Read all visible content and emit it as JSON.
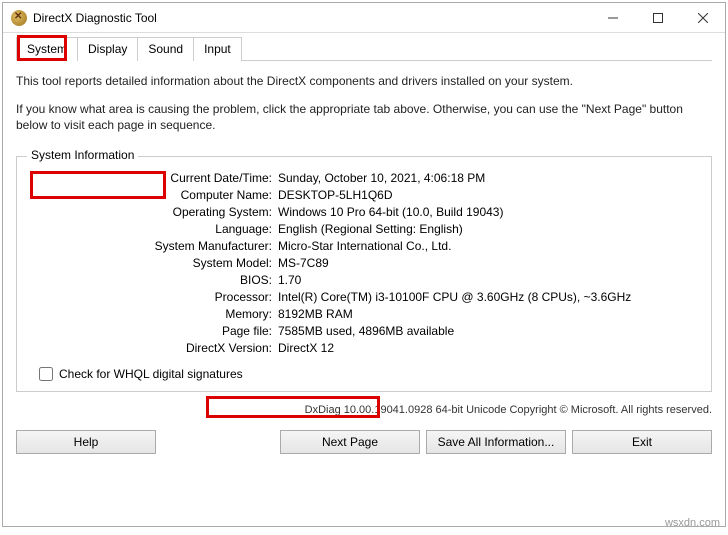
{
  "window": {
    "title": "DirectX Diagnostic Tool"
  },
  "tabs": [
    "System",
    "Display",
    "Sound",
    "Input"
  ],
  "intro": {
    "p1": "This tool reports detailed information about the DirectX components and drivers installed on your system.",
    "p2": "If you know what area is causing the problem, click the appropriate tab above.  Otherwise, you can use the \"Next Page\" button below to visit each page in sequence."
  },
  "group": {
    "title": "System Information"
  },
  "info": {
    "date_label": "Current Date/Time:",
    "date_val": "Sunday, October 10, 2021, 4:06:18 PM",
    "name_label": "Computer Name:",
    "name_val": "DESKTOP-5LH1Q6D",
    "os_label": "Operating System:",
    "os_val": "Windows 10 Pro 64-bit (10.0, Build 19043)",
    "lang_label": "Language:",
    "lang_val": "English (Regional Setting: English)",
    "manu_label": "System Manufacturer:",
    "manu_val": "Micro-Star International Co., Ltd.",
    "model_label": "System Model:",
    "model_val": "MS-7C89",
    "bios_label": "BIOS:",
    "bios_val": "1.70",
    "proc_label": "Processor:",
    "proc_val": "Intel(R) Core(TM) i3-10100F CPU @ 3.60GHz (8 CPUs), ~3.6GHz",
    "mem_label": "Memory:",
    "mem_val": "8192MB RAM",
    "page_label": "Page file:",
    "page_val": "7585MB used, 4896MB available",
    "dx_label": "DirectX Version:",
    "dx_val": "DirectX 12"
  },
  "whql": {
    "label": "Check for WHQL digital signatures"
  },
  "footer": "DxDiag 10.00.19041.0928 64-bit Unicode   Copyright © Microsoft. All rights reserved.",
  "buttons": {
    "help": "Help",
    "next": "Next Page",
    "save": "Save All Information...",
    "exit": "Exit"
  },
  "watermark": "wsxdn.com"
}
